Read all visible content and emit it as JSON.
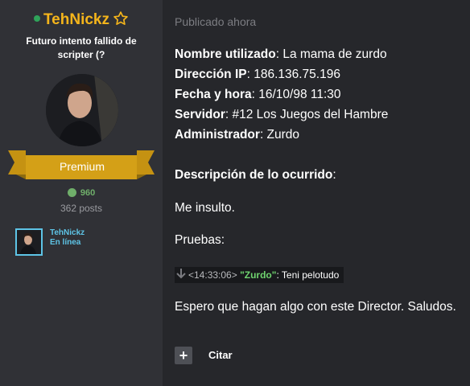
{
  "author": {
    "name": "TehNickz",
    "title": "Futuro intento fallido de scripter (?",
    "rank": "Premium",
    "reputation": "960",
    "posts": "362 posts",
    "last_editor_name": "TehNickz",
    "last_editor_status": "En línea"
  },
  "post": {
    "published": "Publicado ahora",
    "fields": [
      {
        "label": "Nombre utilizado",
        "value": ": La mama de zurdo"
      },
      {
        "label": "Dirección IP",
        "value": ": 186.136.75.196"
      },
      {
        "label": "Fecha y hora",
        "value": ": 16/10/98 11:30"
      },
      {
        "label": "Servidor",
        "value": ": #12 Los Juegos del Hambre"
      },
      {
        "label": "Administrador",
        "value": ": Zurdo"
      }
    ],
    "description_label": "Descripción de lo ocurrido",
    "description_colon": ":",
    "description": "Me insulto.",
    "evidence_label": "Pruebas:",
    "chat": {
      "time": "<14:33:06>",
      "user": "\"Zurdo\"",
      "separator": ": ",
      "message": "Teni pelotudo"
    },
    "closing": "Espero que hagan algo con este Director. Saludos."
  },
  "actions": {
    "quote_label": "Citar"
  },
  "colors": {
    "background": "#26272b",
    "sidebar": "#303136",
    "username": "#f5b51b",
    "ribbon": "#d4a017",
    "online": "#2fa35a",
    "reputation": "#6fae6a",
    "link": "#5ec4e6",
    "chat_user": "#6fd36f"
  }
}
